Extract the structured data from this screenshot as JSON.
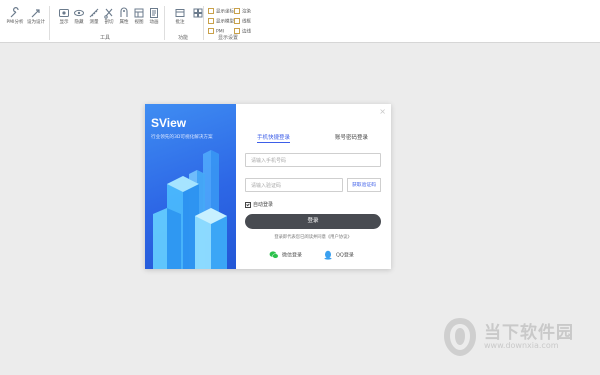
{
  "ribbon": {
    "buttons": [
      {
        "label": "PMI分析",
        "icon": "wrench-icon"
      },
      {
        "label": "设为设计",
        "icon": "arrow-tool-icon"
      },
      {
        "label": "显示",
        "icon": "eye-icon"
      },
      {
        "label": "隐藏",
        "icon": "eye-hide-icon"
      },
      {
        "label": "测量",
        "icon": "ruler-icon"
      },
      {
        "label": "剖切",
        "icon": "cut-icon"
      },
      {
        "label": "属性",
        "icon": "properties-icon"
      },
      {
        "label": "视图",
        "icon": "view-icon"
      },
      {
        "label": "动画",
        "icon": "animation-icon"
      },
      {
        "label": "批注",
        "icon": "note-icon"
      }
    ],
    "groups": {
      "tools": "工具",
      "features": "功能",
      "display": "显示设置"
    },
    "options": [
      "显示坐标",
      "显示模型",
      "PMI",
      "渲染",
      "线框",
      "边线"
    ]
  },
  "dialog": {
    "brand": "SView",
    "slogan": "行业领先的3D可视化解决方案",
    "close": "×",
    "tabs": [
      "手机快捷登录",
      "账号密码登录"
    ],
    "phone_placeholder": "请输入手机号码",
    "code_placeholder": "请输入验证码",
    "code_button": "获取验证码",
    "remember": "自动登录",
    "login_button": "登录",
    "agreement": "登录即代表您已阅读并同意《用户协议》",
    "social": [
      {
        "label": "微信登录",
        "icon": "wechat-icon"
      },
      {
        "label": "QQ登录",
        "icon": "qq-icon"
      }
    ]
  },
  "watermark": {
    "name": "当下软件园",
    "url": "www.downxia.com"
  }
}
